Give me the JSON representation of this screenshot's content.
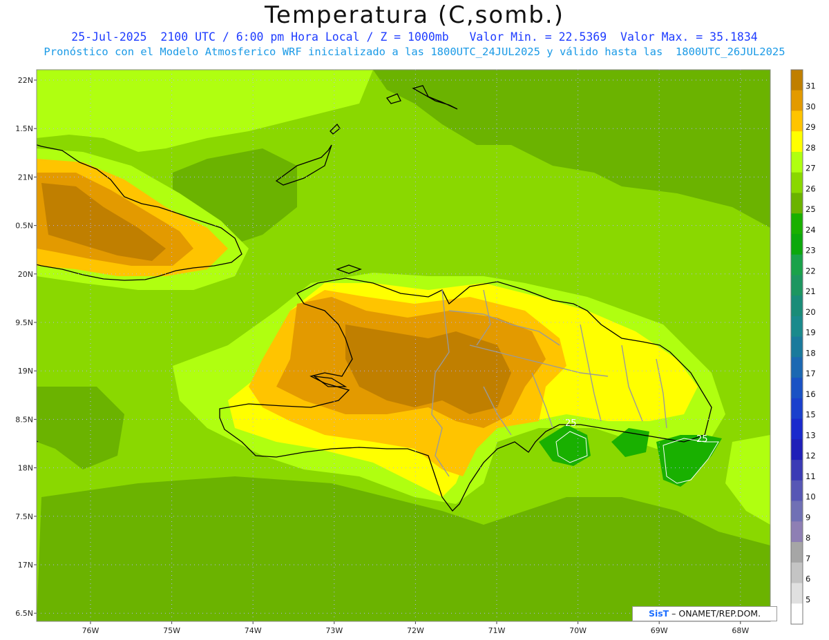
{
  "title": "Temperatura (C,somb.)",
  "subtitle_line1": "25-Jul-2025  2100 UTC / 6:00 pm Hora Local / Z = 1000mb   Valor Min. = 22.5369  Valor Max. = 35.1834",
  "subtitle_line2": "Pronóstico con el Modelo Atmosferico WRF inicializado a las 1800UTC_24JUL2025 y válido hasta las  1800UTC_26JUL2025",
  "credit": {
    "brand": "SisT",
    "text": " – ONAMET/REP.DOM."
  },
  "lat_labels": [
    "22N",
    "1.5N",
    "21N",
    "0.5N",
    "20N",
    "9.5N",
    "19N",
    "8.5N",
    "18N",
    "7.5N",
    "17N",
    "6.5N"
  ],
  "lon_labels": [
    "76W",
    "75W",
    "74W",
    "73W",
    "72W",
    "71W",
    "70W",
    "69W",
    "68W"
  ],
  "contour_labels": [
    "25",
    "25"
  ],
  "colorbar": {
    "labels": [
      "31",
      "30",
      "29",
      "28",
      "27",
      "26",
      "25",
      "24",
      "23",
      "22",
      "21",
      "20",
      "19",
      "18",
      "17",
      "16",
      "15",
      "13",
      "12",
      "11",
      "10",
      "9",
      "8",
      "7",
      "6",
      "5"
    ],
    "colors": [
      "#c07f00",
      "#e39a00",
      "#ffc400",
      "#ffff00",
      "#b0ff10",
      "#8ad800",
      "#6bb300",
      "#19b000",
      "#0ca80c",
      "#1aa24a",
      "#1d9660",
      "#1a8c78",
      "#1a8a8c",
      "#1a7a9c",
      "#1c68b2",
      "#1a52c4",
      "#1a40cc",
      "#1a2acc",
      "#1f1fb8",
      "#3b3bb5",
      "#5757b5",
      "#7070b5",
      "#8e7fb4",
      "#a6a6a6",
      "#c4c4c4",
      "#e0e0e0",
      "#ffffff"
    ]
  },
  "colors": {
    "sea": "#8ad800",
    "sea_warm": "#b0ff10",
    "sea_cool": "#6bb300",
    "land_hot": "#c07f00",
    "land_warm": "#e39a00",
    "land_mid": "#ffc400",
    "land_yellow": "#ffff00",
    "cool_green": "#19b000",
    "coast": "#000000",
    "border": "#9a9a9a"
  }
}
